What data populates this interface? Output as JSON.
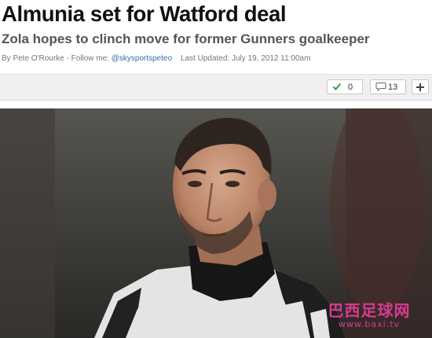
{
  "article": {
    "headline": "Almunia set for Watford deal",
    "subheadline": "Zola hopes to clinch move for former Gunners goalkeeper",
    "byline": {
      "author": "By Pete O'Rourke - Follow me:",
      "handle": "@skysportspeteo",
      "updated": "Last Updated: July 19, 2012 11:00am"
    }
  },
  "actions": {
    "like_count": "0",
    "comment_count": "13",
    "like_icon": "check-icon",
    "comment_icon": "speech-bubble-icon",
    "add_icon": "plus-icon"
  },
  "photo": {
    "watermark_title": "巴西足球网",
    "watermark_url": "www.baxi.tv"
  },
  "colors": {
    "accent_handle": "#3b6aa8",
    "check_green": "#3a9a3a",
    "watermark_pink": "#d93a92"
  }
}
